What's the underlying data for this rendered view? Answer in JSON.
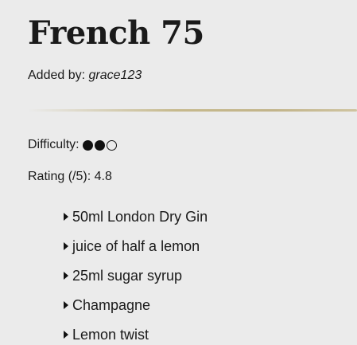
{
  "recipe": {
    "title": "French 75",
    "added_by_label": "Added by:",
    "added_by_user": "grace123",
    "difficulty_label": "Difficulty:",
    "difficulty_level": 2,
    "difficulty_max": 3,
    "rating_label": "Rating (/5):",
    "rating_value": "4.8",
    "ingredients": [
      "50ml London Dry Gin",
      "juice of half a lemon",
      "25ml sugar syrup",
      "Champagne",
      "Lemon twist"
    ]
  },
  "colors": {
    "background": "#ebebeb",
    "text": "#1a1a1a",
    "divider_gold": "#c6b98c"
  },
  "icons": {
    "difficulty_filled": "filled-circle-icon",
    "difficulty_empty": "empty-circle-icon",
    "list_marker": "triangle-right-icon"
  }
}
